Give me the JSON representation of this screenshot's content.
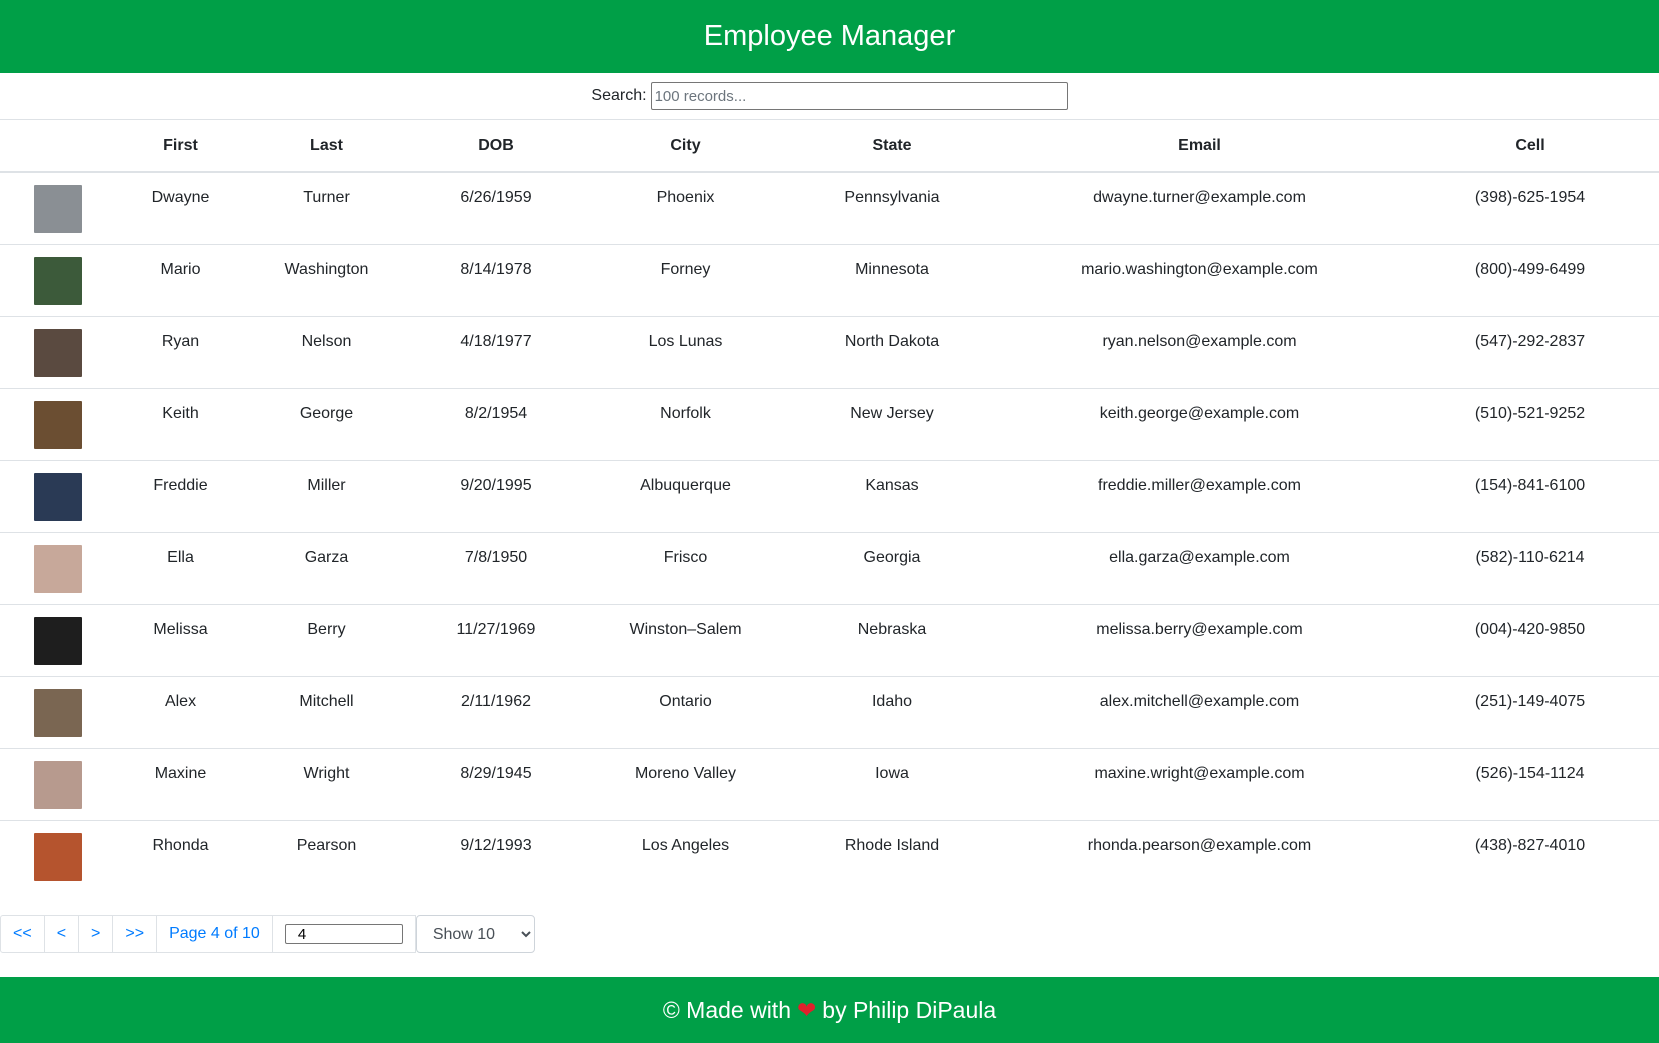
{
  "header": {
    "title": "Employee Manager"
  },
  "search": {
    "label": "Search:",
    "placeholder": "100 records..."
  },
  "table": {
    "columns": [
      "",
      "First",
      "Last",
      "DOB",
      "City",
      "State",
      "Email",
      "Cell"
    ],
    "rows": [
      {
        "first": "Dwayne",
        "last": "Turner",
        "dob": "6/26/1959",
        "city": "Phoenix",
        "state": "Pennsylvania",
        "email": "dwayne.turner@example.com",
        "cell": "(398)-625-1954",
        "avatar_color": "#8a8f94"
      },
      {
        "first": "Mario",
        "last": "Washington",
        "dob": "8/14/1978",
        "city": "Forney",
        "state": "Minnesota",
        "email": "mario.washington@example.com",
        "cell": "(800)-499-6499",
        "avatar_color": "#3c5a3a"
      },
      {
        "first": "Ryan",
        "last": "Nelson",
        "dob": "4/18/1977",
        "city": "Los Lunas",
        "state": "North Dakota",
        "email": "ryan.nelson@example.com",
        "cell": "(547)-292-2837",
        "avatar_color": "#5a4a40"
      },
      {
        "first": "Keith",
        "last": "George",
        "dob": "8/2/1954",
        "city": "Norfolk",
        "state": "New Jersey",
        "email": "keith.george@example.com",
        "cell": "(510)-521-9252",
        "avatar_color": "#6b4e32"
      },
      {
        "first": "Freddie",
        "last": "Miller",
        "dob": "9/20/1995",
        "city": "Albuquerque",
        "state": "Kansas",
        "email": "freddie.miller@example.com",
        "cell": "(154)-841-6100",
        "avatar_color": "#2a3a55"
      },
      {
        "first": "Ella",
        "last": "Garza",
        "dob": "7/8/1950",
        "city": "Frisco",
        "state": "Georgia",
        "email": "ella.garza@example.com",
        "cell": "(582)-110-6214",
        "avatar_color": "#c7a89a"
      },
      {
        "first": "Melissa",
        "last": "Berry",
        "dob": "11/27/1969",
        "city": "Winston–Salem",
        "state": "Nebraska",
        "email": "melissa.berry@example.com",
        "cell": "(004)-420-9850",
        "avatar_color": "#1e1e1e"
      },
      {
        "first": "Alex",
        "last": "Mitchell",
        "dob": "2/11/1962",
        "city": "Ontario",
        "state": "Idaho",
        "email": "alex.mitchell@example.com",
        "cell": "(251)-149-4075",
        "avatar_color": "#7a6652"
      },
      {
        "first": "Maxine",
        "last": "Wright",
        "dob": "8/29/1945",
        "city": "Moreno Valley",
        "state": "Iowa",
        "email": "maxine.wright@example.com",
        "cell": "(526)-154-1124",
        "avatar_color": "#b79a8e"
      },
      {
        "first": "Rhonda",
        "last": "Pearson",
        "dob": "9/12/1993",
        "city": "Los Angeles",
        "state": "Rhode Island",
        "email": "rhonda.pearson@example.com",
        "cell": "(438)-827-4010",
        "avatar_color": "#b5542e"
      }
    ]
  },
  "pagination": {
    "first": "<<",
    "prev": "<",
    "next": ">",
    "last": ">>",
    "page_text": "Page 4 of 10",
    "page_input_value": "4",
    "page_size_selected": "Show 10"
  },
  "footer": {
    "prefix": "© Made with",
    "heart": "❤",
    "suffix": "by Philip DiPaula"
  },
  "colors": {
    "brand": "#009f47",
    "link": "#007bff"
  }
}
